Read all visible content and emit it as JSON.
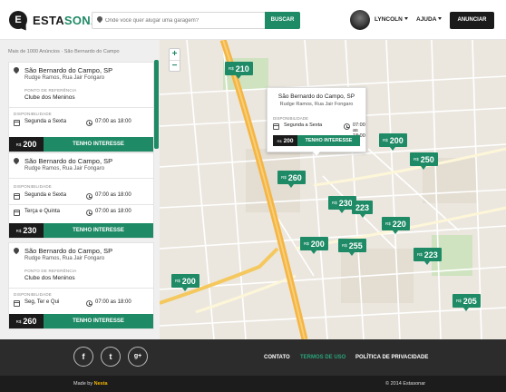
{
  "header": {
    "logo": {
      "part1": "ESTA",
      "part2": "SONAR"
    },
    "search_placeholder": "Onde você quer alugar uma garagem?",
    "search_button": "BUSCAR",
    "user_label": "LYNCOLN",
    "help_label": "AJUDA",
    "cta_label": "ANUNCIAR"
  },
  "sidebar": {
    "summary": "Mais de 1000 Anúncios · São Bernardo do Campo",
    "reference_label": "PONTO DE REFERÊNCIA",
    "availability_label": "DISPONIBILIDADE",
    "currency": "R$",
    "interest_label": "TENHO INTERESSE",
    "cards": [
      {
        "city": "São Bernardo do Campo, SP",
        "street": "Rudge Ramos, Rua Jair Fongaro",
        "reference": "Clube dos Meninos",
        "schedule": [
          {
            "days": "Segunda a Sexta",
            "time": "07:00 as 18:00"
          }
        ],
        "price": "200"
      },
      {
        "city": "São Bernardo do Campo, SP",
        "street": "Rudge Ramos, Rua Jair Fongaro",
        "schedule": [
          {
            "days": "Segunda e Sexta",
            "time": "07:00 as 18:00"
          },
          {
            "days": "Terça e Quinta",
            "time": "07:00 as 18:00"
          }
        ],
        "price": "230"
      },
      {
        "city": "São Bernardo do Campo, SP",
        "street": "Rudge Ramos, Rua Jair Fongaro",
        "reference": "Clube dos Meninos",
        "schedule": [
          {
            "days": "Seg, Ter e Qui",
            "time": "07:00 as 18:00"
          }
        ],
        "price": "260"
      }
    ]
  },
  "map": {
    "zoom_in": "+",
    "zoom_out": "−",
    "currency": "R$",
    "markers": [
      "210",
      "200",
      "260",
      "250",
      "230",
      "223",
      "220",
      "200",
      "255",
      "223",
      "200",
      "205"
    ],
    "popup": {
      "city": "São Bernardo do Campo, SP",
      "street": "Rudge Ramos, Rua Jair Fongaro",
      "availability_label": "DISPONIBILIDADE",
      "days": "Segunda a Sexta",
      "time": "07:00 as 18:00",
      "price": "200",
      "interest_label": "TENHO INTERESSE"
    }
  },
  "footer": {
    "social": {
      "facebook": "f",
      "twitter": "t",
      "google": "g+"
    },
    "links": [
      "CONTATO",
      "TERMOS DE USO",
      "POLÍTICA DE PRIVACIDADE"
    ],
    "made_by_prefix": "Made by",
    "made_by_name": "Nesta",
    "copyright": "© 2014 Estasonar"
  },
  "colors": {
    "brand_green": "#1f8a66",
    "dark": "#1b1b1b",
    "footer": "#2c2c2c",
    "highway": "#f5b544"
  }
}
